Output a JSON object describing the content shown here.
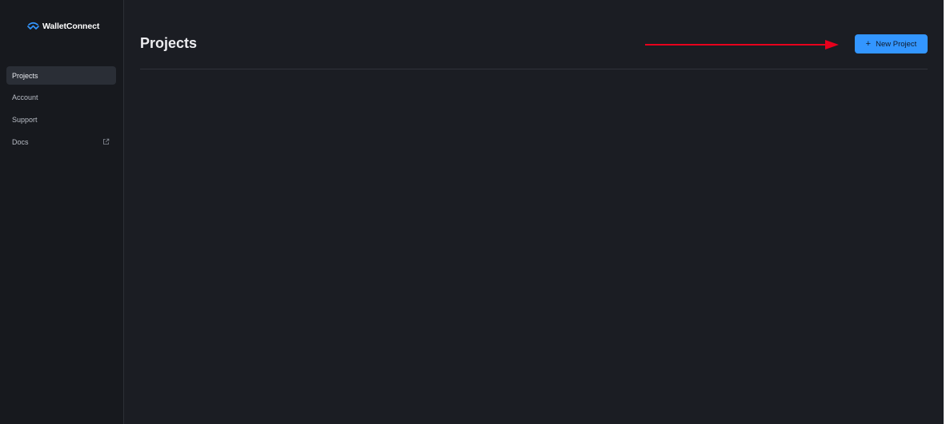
{
  "brand": {
    "name": "WalletConnect",
    "icon": "walletconnect-logo-icon",
    "color": "#3396ff"
  },
  "sidebar": {
    "items": [
      {
        "label": "Projects",
        "active": true
      },
      {
        "label": "Account",
        "active": false
      },
      {
        "label": "Support",
        "active": false
      },
      {
        "label": "Docs",
        "active": false,
        "icon": "external-link-icon"
      }
    ]
  },
  "main": {
    "title": "Projects",
    "new_button": {
      "label": "New Project",
      "icon": "plus-icon",
      "color": "#3396ff"
    },
    "annotation_arrow_color": "#e8001c"
  }
}
